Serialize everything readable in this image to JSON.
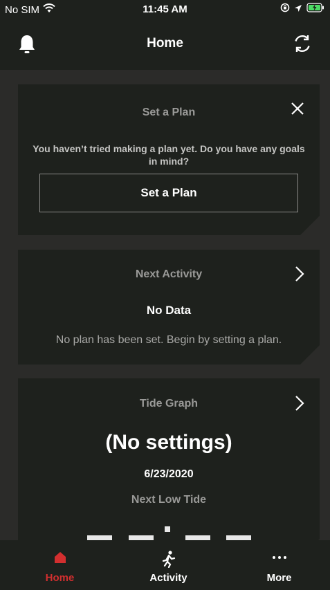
{
  "status_bar": {
    "carrier": "No SIM",
    "time": "11:45 AM"
  },
  "header": {
    "title": "Home",
    "left_icon": "bell-icon",
    "right_icon": "sync-icon"
  },
  "cards": {
    "plan": {
      "title": "Set a Plan",
      "message": "You haven’t tried making a plan yet. Do you have any goals in mind?",
      "button_label": "Set a Plan"
    },
    "next_activity": {
      "title": "Next Activity",
      "status": "No Data",
      "message": "No plan has been set. Begin by setting a plan."
    },
    "tide_graph": {
      "title": "Tide Graph",
      "value": "(No settings)",
      "date": "6/23/2020",
      "next_label": "Next Low Tide"
    }
  },
  "tabs": [
    {
      "label": "Home",
      "icon": "home-icon",
      "active": true
    },
    {
      "label": "Activity",
      "icon": "running-icon",
      "active": false
    },
    {
      "label": "More",
      "icon": "more-icon",
      "active": false
    }
  ],
  "colors": {
    "background": "#2b2b29",
    "surface": "#1e211d",
    "accent": "#d32f2f",
    "muted_text": "#9a9a98"
  }
}
